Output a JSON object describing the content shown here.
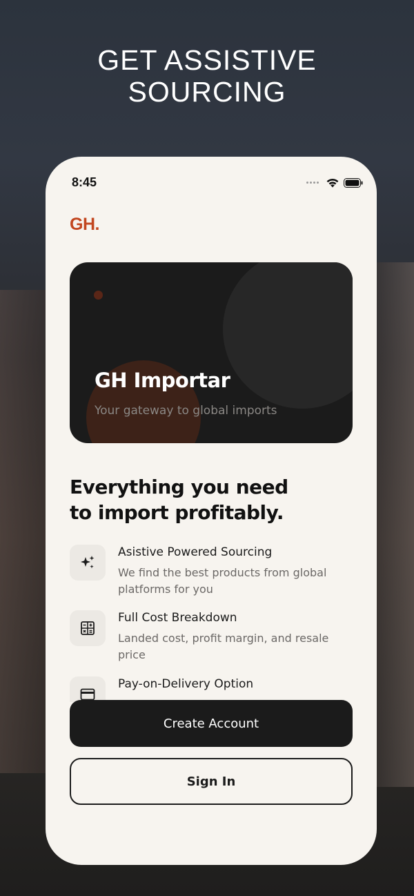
{
  "headline": {
    "line1": "GET ASSISTIVE",
    "line2": "SOURCING"
  },
  "status_bar": {
    "time": "8:45"
  },
  "brand": {
    "logo_text": "GH.",
    "color": "#c2461f"
  },
  "hero": {
    "title": "GH Importar",
    "subtitle": "Your gateway to global imports"
  },
  "section": {
    "heading_line1": "Everything you need",
    "heading_line2": "to import profitably."
  },
  "features": [
    {
      "icon": "sparkles-icon",
      "title": "Asistive Powered Sourcing",
      "description": "We find the best products from global platforms for you"
    },
    {
      "icon": "calculator-icon",
      "title": "Full Cost Breakdown",
      "description": "Landed cost, profit margin, and resale price"
    },
    {
      "icon": "credit-card-icon",
      "title": "Pay-on-Delivery Option",
      "description": ""
    }
  ],
  "actions": {
    "create_account": "Create Account",
    "sign_in": "Sign In"
  },
  "colors": {
    "accent": "#c2461f",
    "dark": "#1b1b1b",
    "surface": "#f7f4ef"
  }
}
